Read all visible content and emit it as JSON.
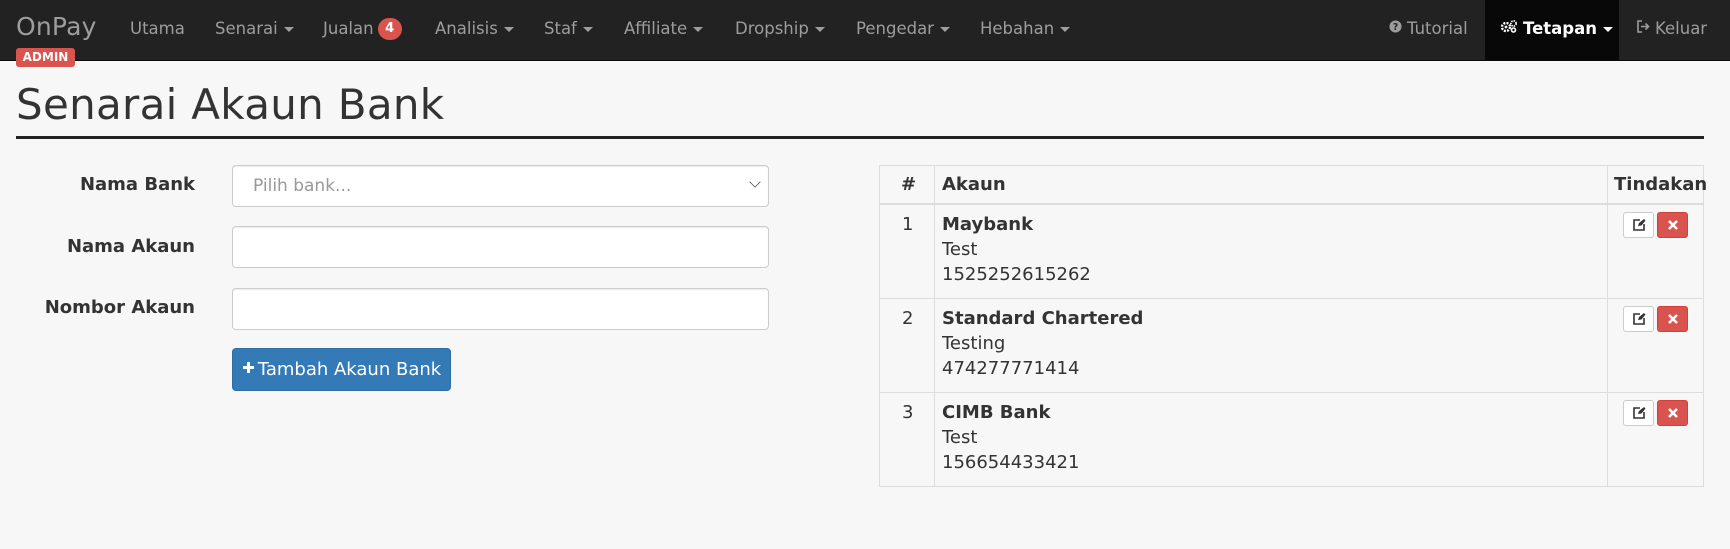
{
  "navbar": {
    "brand": "OnPay",
    "role_badge": "ADMIN",
    "items": [
      {
        "label": "Utama",
        "dropdown": false
      },
      {
        "label": "Senarai",
        "dropdown": true
      },
      {
        "label": "Jualan",
        "dropdown": false,
        "badge": "4"
      },
      {
        "label": "Analisis",
        "dropdown": true
      },
      {
        "label": "Staf",
        "dropdown": true
      },
      {
        "label": "Affiliate",
        "dropdown": true
      },
      {
        "label": "Dropship",
        "dropdown": true
      },
      {
        "label": "Pengedar",
        "dropdown": true
      },
      {
        "label": "Hebahan",
        "dropdown": true
      }
    ],
    "right": {
      "tutorial": "Tutorial",
      "settings": "Tetapan",
      "logout": "Keluar"
    }
  },
  "page": {
    "title": "Senarai Akaun Bank"
  },
  "form": {
    "bank_label": "Nama Bank",
    "bank_placeholder": "Pilih bank...",
    "account_name_label": "Nama Akaun",
    "account_name_value": "",
    "account_number_label": "Nombor Akaun",
    "account_number_value": "",
    "submit_label": "Tambah Akaun Bank"
  },
  "table": {
    "headers": {
      "num": "#",
      "account": "Akaun",
      "actions": "Tindakan"
    },
    "rows": [
      {
        "num": "1",
        "bank": "Maybank",
        "name": "Test",
        "number": "1525252615262"
      },
      {
        "num": "2",
        "bank": "Standard Chartered",
        "name": "Testing",
        "number": "474277771414"
      },
      {
        "num": "3",
        "bank": "CIMB Bank",
        "name": "Test",
        "number": "156654433421"
      }
    ]
  },
  "colors": {
    "navbar_bg": "#222222",
    "primary": "#337ab7",
    "danger": "#d9534f"
  }
}
